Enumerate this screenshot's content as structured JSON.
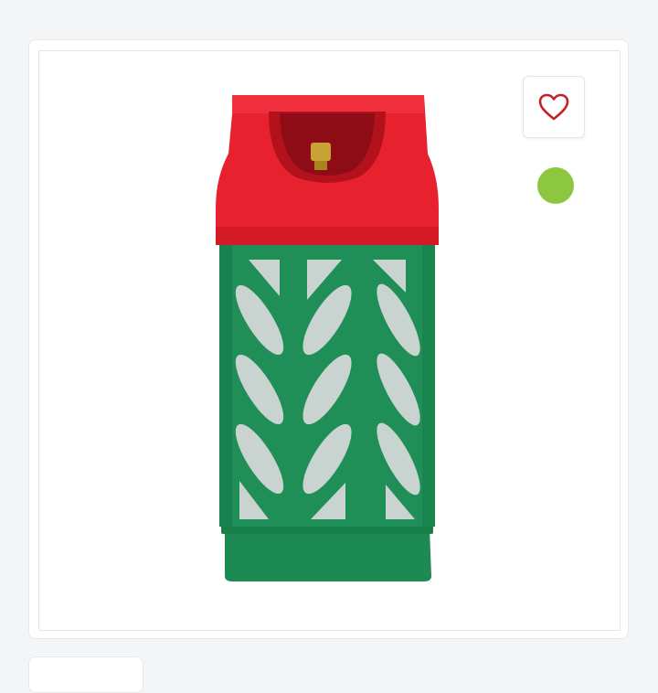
{
  "product": {
    "image_icon": "gas-cylinder-image",
    "colors": {
      "cap": "#e8212e",
      "body": "#1f8f57",
      "windows": "#c9d3d0"
    }
  },
  "favorite": {
    "icon": "heart-outline-icon",
    "color": "#c0222a"
  },
  "availability": {
    "color": "#8dc63f"
  }
}
